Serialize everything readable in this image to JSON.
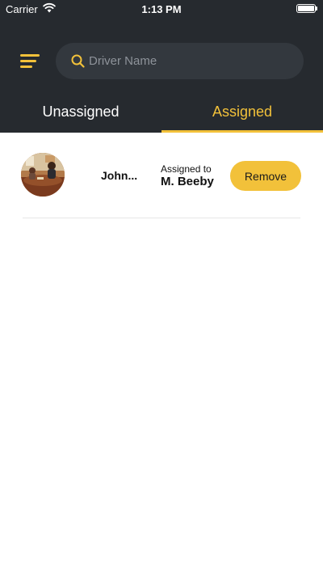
{
  "status_bar": {
    "carrier": "Carrier",
    "time": "1:13 PM",
    "wifi_icon": "wifi-icon",
    "battery_icon": "battery-icon",
    "battery_level": 1.0
  },
  "header": {
    "menu_icon": "hamburger-menu-icon",
    "search": {
      "icon": "search-icon",
      "placeholder": "Driver Name",
      "value": ""
    }
  },
  "tabs": [
    {
      "label": "Unassigned",
      "active": false
    },
    {
      "label": "Assigned",
      "active": true
    }
  ],
  "assignments": [
    {
      "avatar": "driver-photo",
      "driver_name": "John...",
      "assigned_caption": "Assigned to",
      "assigned_to": "M. Beeby",
      "action_label": "Remove"
    }
  ],
  "colors": {
    "header_bg": "#262a2f",
    "search_bg": "#33383e",
    "accent": "#f2c13a",
    "text_light": "#ffffff",
    "text_dark": "#111111",
    "divider": "#e7e7e7"
  }
}
